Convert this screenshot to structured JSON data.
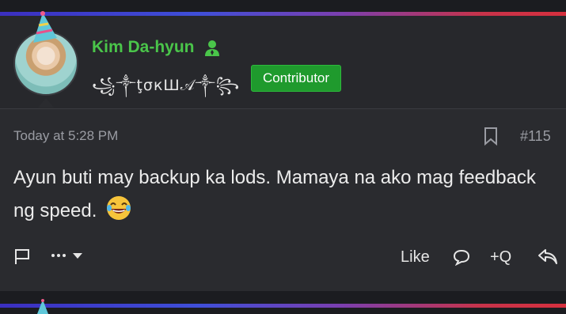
{
  "post": {
    "author": {
      "name": "Kim Da-hyun",
      "fancy_title": "꧁༒ţσкШ𝒜༒꧂",
      "badge": "Contributor"
    },
    "timestamp": "Today at 5:28 PM",
    "post_number": "#115",
    "message": "Ayun buti may backup ka lods. Mamaya na ako mag feedback ng speed."
  },
  "actions": {
    "like": "Like",
    "quote": "+Q"
  },
  "colors": {
    "username": "#4ac54a",
    "badge_bg": "#1f9a2d",
    "background": "#2a2b2f"
  },
  "icons": [
    "party-hat-icon",
    "user-tie-icon",
    "bookmark-icon",
    "flag-icon",
    "more-icon",
    "chevron-down-icon",
    "comment-icon",
    "reply-icon",
    "laughing-emoji-icon"
  ]
}
